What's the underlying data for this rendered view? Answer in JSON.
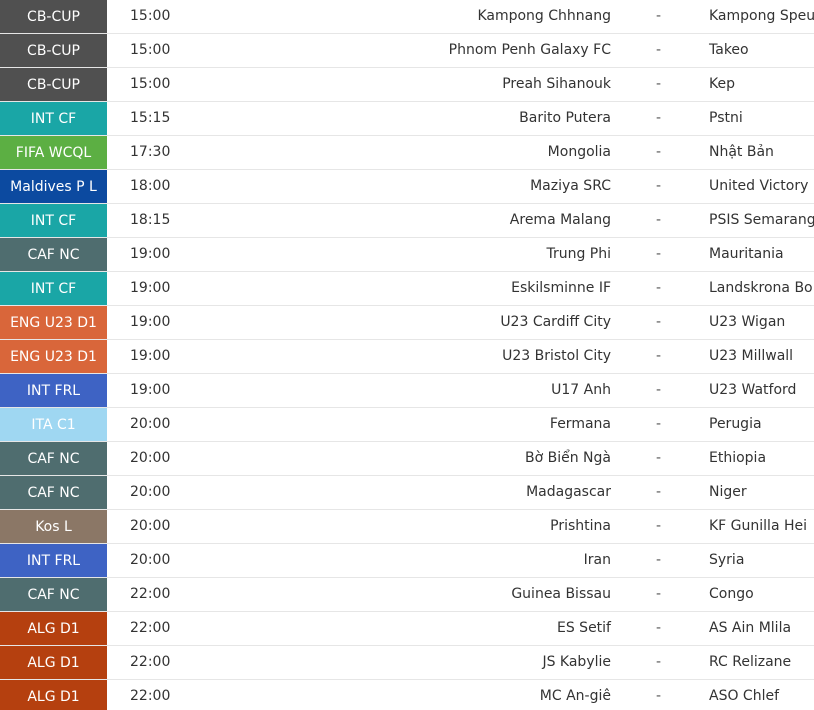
{
  "matches": [
    {
      "league": "CB-CUP",
      "color": "#505050",
      "time": "15:00",
      "home": "Kampong Chhnang",
      "sep": "-",
      "away": "Kampong Speu"
    },
    {
      "league": "CB-CUP",
      "color": "#505050",
      "time": "15:00",
      "home": "Phnom Penh Galaxy FC",
      "sep": "-",
      "away": "Takeo"
    },
    {
      "league": "CB-CUP",
      "color": "#505050",
      "time": "15:00",
      "home": "Preah Sihanouk",
      "sep": "-",
      "away": "Kep"
    },
    {
      "league": "INT CF",
      "color": "#1aa6a6",
      "time": "15:15",
      "home": "Barito Putera",
      "sep": "-",
      "away": "Pstni"
    },
    {
      "league": "FIFA WCQL",
      "color": "#5caf43",
      "time": "17:30",
      "home": "Mongolia",
      "sep": "-",
      "away": "Nhật Bản"
    },
    {
      "league": "Maldives P L",
      "color": "#0c4aa0",
      "time": "18:00",
      "home": "Maziya SRC",
      "sep": "-",
      "away": "United Victory"
    },
    {
      "league": "INT CF",
      "color": "#1aa6a6",
      "time": "18:15",
      "home": "Arema Malang",
      "sep": "-",
      "away": "PSIS Semarang"
    },
    {
      "league": "CAF NC",
      "color": "#4f6d6f",
      "time": "19:00",
      "home": "Trung Phi",
      "sep": "-",
      "away": "Mauritania"
    },
    {
      "league": "INT CF",
      "color": "#1aa6a6",
      "time": "19:00",
      "home": "Eskilsminne IF",
      "sep": "-",
      "away": "Landskrona BoIS"
    },
    {
      "league": "ENG U23 D1",
      "color": "#d9663a",
      "time": "19:00",
      "home": "U23 Cardiff City",
      "sep": "-",
      "away": "U23 Wigan"
    },
    {
      "league": "ENG U23 D1",
      "color": "#d9663a",
      "time": "19:00",
      "home": "U23 Bristol City",
      "sep": "-",
      "away": "U23 Millwall"
    },
    {
      "league": "INT FRL",
      "color": "#3e63c4",
      "time": "19:00",
      "home": "U17 Anh",
      "sep": "-",
      "away": "U23 Watford"
    },
    {
      "league": "ITA C1",
      "color": "#9fd7f2",
      "time": "20:00",
      "home": "Fermana",
      "sep": "-",
      "away": "Perugia"
    },
    {
      "league": "CAF NC",
      "color": "#4f6d6f",
      "time": "20:00",
      "home": "Bờ Biển Ngà",
      "sep": "-",
      "away": "Ethiopia"
    },
    {
      "league": "CAF NC",
      "color": "#4f6d6f",
      "time": "20:00",
      "home": "Madagascar",
      "sep": "-",
      "away": "Niger"
    },
    {
      "league": "Kos L",
      "color": "#8b7766",
      "time": "20:00",
      "home": "Prishtina",
      "sep": "-",
      "away": "KF Gunilla Hei"
    },
    {
      "league": "INT FRL",
      "color": "#3e63c4",
      "time": "20:00",
      "home": "Iran",
      "sep": "-",
      "away": "Syria"
    },
    {
      "league": "CAF NC",
      "color": "#4f6d6f",
      "time": "22:00",
      "home": "Guinea Bissau",
      "sep": "-",
      "away": "Congo"
    },
    {
      "league": "ALG D1",
      "color": "#b5400f",
      "time": "22:00",
      "home": "ES Setif",
      "sep": "-",
      "away": "AS Ain Mlila"
    },
    {
      "league": "ALG D1",
      "color": "#b5400f",
      "time": "22:00",
      "home": "JS Kabylie",
      "sep": "-",
      "away": "RC Relizane"
    },
    {
      "league": "ALG D1",
      "color": "#b5400f",
      "time": "22:00",
      "home": "MC An-giê",
      "sep": "-",
      "away": "ASO Chlef"
    }
  ]
}
